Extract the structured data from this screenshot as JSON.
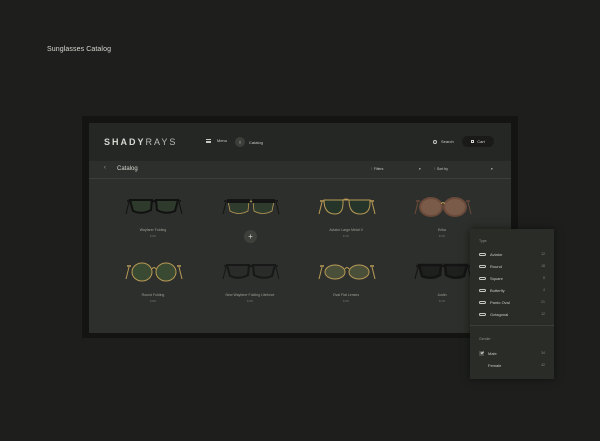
{
  "page": {
    "title": "Sunglasses Catalog"
  },
  "header": {
    "logo_main": "SHADY",
    "logo_sub": "RAYS",
    "menu_label": "Menu",
    "catalog_label": "Catalog",
    "search_label": "Search",
    "cart_label": "Cart"
  },
  "subbar": {
    "title": "Catalog",
    "filters_label": "Filters",
    "sort_label": "Sort by"
  },
  "products": [
    {
      "name": "Wayfarer Folding",
      "price": "$165",
      "style": "wayfarer",
      "frame": "#111111",
      "lens": "#2d3a2c"
    },
    {
      "name": "",
      "price": "",
      "style": "clubmaster",
      "frame": "#151515",
      "lens": "#2f3b2d"
    },
    {
      "name": "Aviator Large Metal II",
      "price": "$145",
      "style": "aviator",
      "frame": "#b89a56",
      "lens": "#26352a"
    },
    {
      "name": "Erika",
      "price": "$150",
      "style": "round-thick",
      "frame": "#6a4a3a",
      "lens": "#7a5a48"
    },
    {
      "name": "Round Folding",
      "price": "$185",
      "style": "round",
      "frame": "#b89a56",
      "lens": "#3a4a32"
    },
    {
      "name": "New Wayfarer Folding Liteforce",
      "price": "$165",
      "style": "wayfarer",
      "frame": "#181818",
      "lens": "#2a2c2a"
    },
    {
      "name": "Oval Flat Lenses",
      "price": "$155",
      "style": "oval",
      "frame": "#b89a56",
      "lens": "#4a4f3a"
    },
    {
      "name": "Justin",
      "price": "$145",
      "style": "wayfarer-thick",
      "frame": "#141414",
      "lens": "#1e201d"
    }
  ],
  "filter_panel": {
    "type_header": "Type",
    "types": [
      {
        "label": "Aviator",
        "count": "12"
      },
      {
        "label": "Round",
        "count": "18"
      },
      {
        "label": "Square",
        "count": "8"
      },
      {
        "label": "Butterfly",
        "count": "4"
      },
      {
        "label": "Panto Oval",
        "count": "21"
      },
      {
        "label": "Octagonal",
        "count": "12"
      }
    ],
    "gender_header": "Gender",
    "genders": [
      {
        "label": "Male",
        "count": "34",
        "checked": true
      },
      {
        "label": "Female",
        "count": "42",
        "checked": false
      }
    ]
  }
}
